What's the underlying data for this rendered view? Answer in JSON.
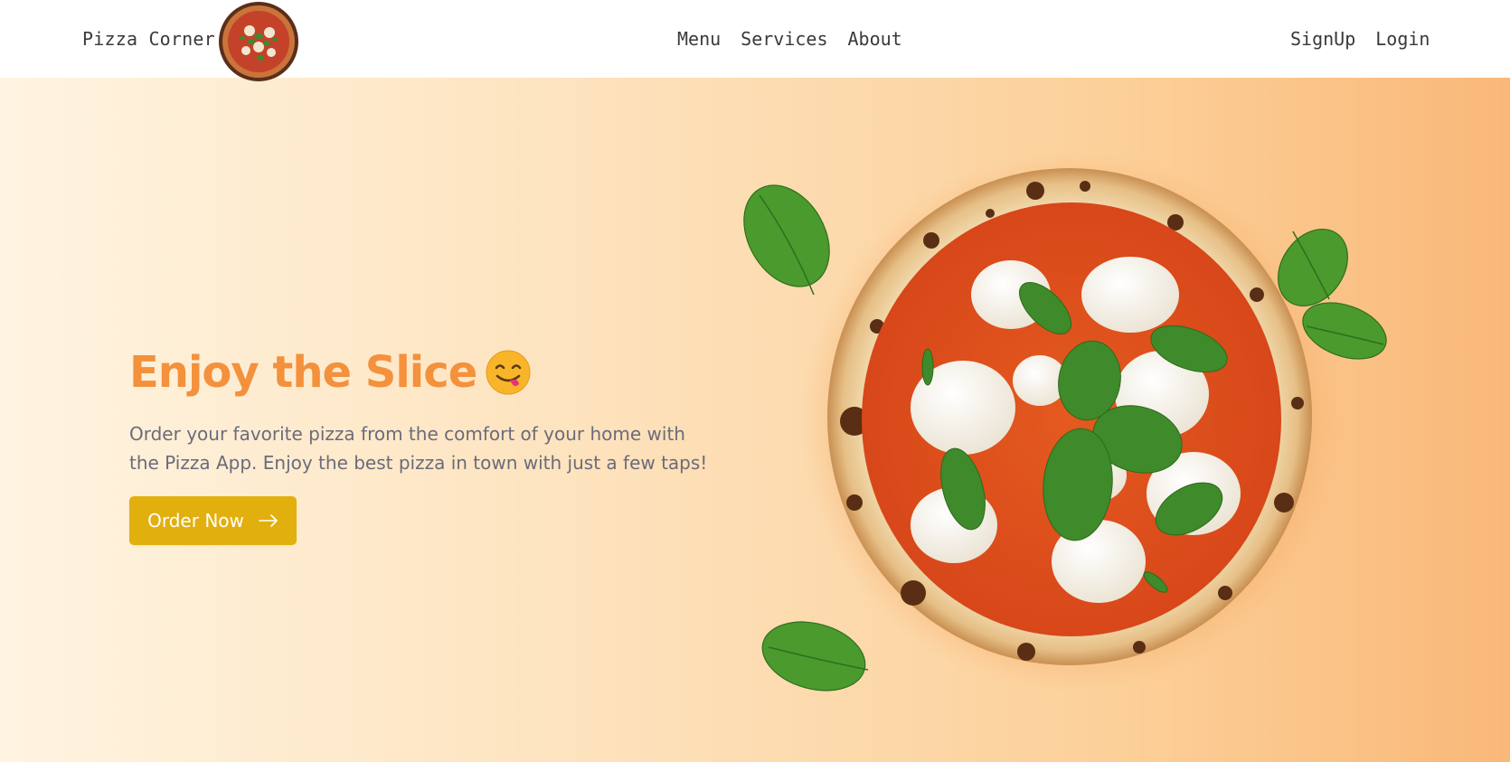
{
  "brand": {
    "name": "Pizza Corner",
    "logo_icon": "pizza-logo-icon"
  },
  "nav": {
    "center": [
      {
        "label": "Menu"
      },
      {
        "label": "Services"
      },
      {
        "label": "About"
      }
    ],
    "right": [
      {
        "label": "SignUp"
      },
      {
        "label": "Login"
      }
    ]
  },
  "hero": {
    "headline": "Enjoy the Slice",
    "headline_emoji": "yummy-face-icon",
    "description": "Order your favorite pizza from the comfort of your home with the Pizza App. Enjoy the best pizza in town with just a few taps!",
    "cta_label": "Order Now",
    "cta_icon": "arrow-right-icon",
    "image": "margherita-pizza-image"
  },
  "colors": {
    "headline": "#f3913c",
    "button": "#e2b00e",
    "text": "#6b6b7a",
    "nav_text": "#3a3a3a"
  }
}
